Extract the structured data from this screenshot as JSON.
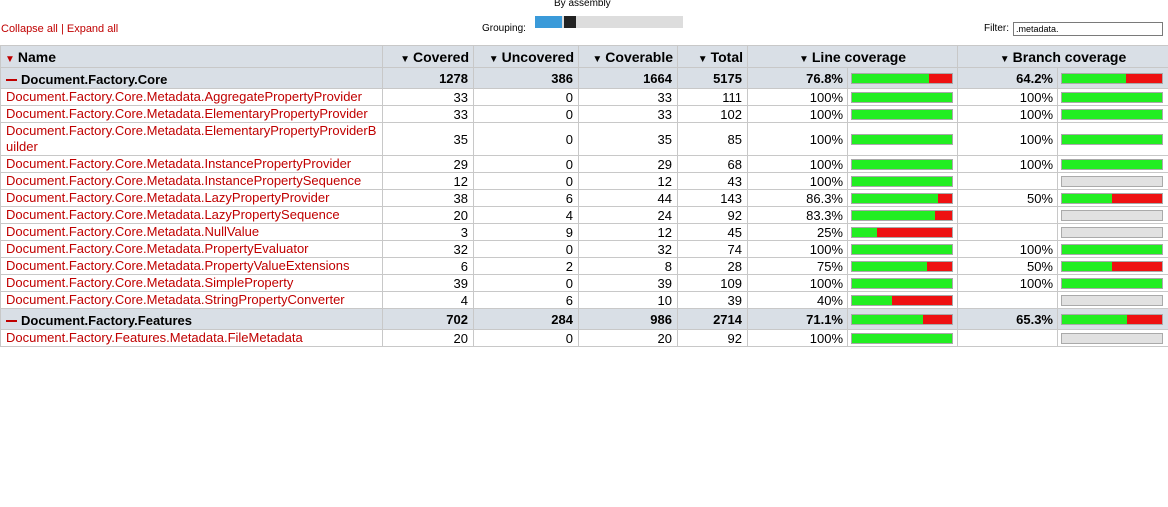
{
  "toolbar": {
    "collapse_all": "Collapse all",
    "separator": "|",
    "expand_all": "Expand all",
    "grouping_label": "Grouping:",
    "grouping_value": "By assembly",
    "grouping_level": 0.18,
    "filter_label": "Filter:",
    "filter_value": ".metadata."
  },
  "columns": {
    "name": "Name",
    "covered": "Covered",
    "uncovered": "Uncovered",
    "coverable": "Coverable",
    "total": "Total",
    "line_coverage": "Line coverage",
    "branch_coverage": "Branch coverage"
  },
  "colors": {
    "covered": "#22ee22",
    "uncovered": "#ee1111",
    "link": "#c00000",
    "header_bg": "#d9dfe6"
  },
  "groups": [
    {
      "name": "Document.Factory.Core",
      "covered": "1278",
      "uncovered": "386",
      "coverable": "1664",
      "total": "5175",
      "line_pct": "76.8%",
      "line_cov": 76.8,
      "branch_pct": "64.2%",
      "branch_cov": 64.2,
      "rows": [
        {
          "name": "Document.Factory.Core.Metadata.AggregatePropertyProvider",
          "covered": "33",
          "uncovered": "0",
          "coverable": "33",
          "total": "111",
          "line_pct": "100%",
          "line_cov": 100,
          "branch_pct": "100%",
          "branch_cov": 100
        },
        {
          "name": "Document.Factory.Core.Metadata.ElementaryPropertyProvider",
          "covered": "33",
          "uncovered": "0",
          "coverable": "33",
          "total": "102",
          "line_pct": "100%",
          "line_cov": 100,
          "branch_pct": "100%",
          "branch_cov": 100
        },
        {
          "name": "Document.Factory.Core.Metadata.ElementaryPropertyProviderBuilder",
          "covered": "35",
          "uncovered": "0",
          "coverable": "35",
          "total": "85",
          "line_pct": "100%",
          "line_cov": 100,
          "branch_pct": "100%",
          "branch_cov": 100
        },
        {
          "name": "Document.Factory.Core.Metadata.InstancePropertyProvider",
          "covered": "29",
          "uncovered": "0",
          "coverable": "29",
          "total": "68",
          "line_pct": "100%",
          "line_cov": 100,
          "branch_pct": "100%",
          "branch_cov": 100
        },
        {
          "name": "Document.Factory.Core.Metadata.InstancePropertySequence",
          "covered": "12",
          "uncovered": "0",
          "coverable": "12",
          "total": "43",
          "line_pct": "100%",
          "line_cov": 100,
          "branch_pct": "",
          "branch_cov": null
        },
        {
          "name": "Document.Factory.Core.Metadata.LazyPropertyProvider",
          "covered": "38",
          "uncovered": "6",
          "coverable": "44",
          "total": "143",
          "line_pct": "86.3%",
          "line_cov": 86.3,
          "branch_pct": "50%",
          "branch_cov": 50
        },
        {
          "name": "Document.Factory.Core.Metadata.LazyPropertySequence",
          "covered": "20",
          "uncovered": "4",
          "coverable": "24",
          "total": "92",
          "line_pct": "83.3%",
          "line_cov": 83.3,
          "branch_pct": "",
          "branch_cov": null
        },
        {
          "name": "Document.Factory.Core.Metadata.NullValue",
          "covered": "3",
          "uncovered": "9",
          "coverable": "12",
          "total": "45",
          "line_pct": "25%",
          "line_cov": 25,
          "branch_pct": "",
          "branch_cov": null
        },
        {
          "name": "Document.Factory.Core.Metadata.PropertyEvaluator",
          "covered": "32",
          "uncovered": "0",
          "coverable": "32",
          "total": "74",
          "line_pct": "100%",
          "line_cov": 100,
          "branch_pct": "100%",
          "branch_cov": 100
        },
        {
          "name": "Document.Factory.Core.Metadata.PropertyValueExtensions",
          "covered": "6",
          "uncovered": "2",
          "coverable": "8",
          "total": "28",
          "line_pct": "75%",
          "line_cov": 75,
          "branch_pct": "50%",
          "branch_cov": 50
        },
        {
          "name": "Document.Factory.Core.Metadata.SimpleProperty",
          "covered": "39",
          "uncovered": "0",
          "coverable": "39",
          "total": "109",
          "line_pct": "100%",
          "line_cov": 100,
          "branch_pct": "100%",
          "branch_cov": 100
        },
        {
          "name": "Document.Factory.Core.Metadata.StringPropertyConverter",
          "covered": "4",
          "uncovered": "6",
          "coverable": "10",
          "total": "39",
          "line_pct": "40%",
          "line_cov": 40,
          "branch_pct": "",
          "branch_cov": null
        }
      ]
    },
    {
      "name": "Document.Factory.Features",
      "covered": "702",
      "uncovered": "284",
      "coverable": "986",
      "total": "2714",
      "line_pct": "71.1%",
      "line_cov": 71.1,
      "branch_pct": "65.3%",
      "branch_cov": 65.3,
      "rows": [
        {
          "name": "Document.Factory.Features.Metadata.FileMetadata",
          "covered": "20",
          "uncovered": "0",
          "coverable": "20",
          "total": "92",
          "line_pct": "100%",
          "line_cov": 100,
          "branch_pct": "",
          "branch_cov": null
        }
      ]
    }
  ]
}
